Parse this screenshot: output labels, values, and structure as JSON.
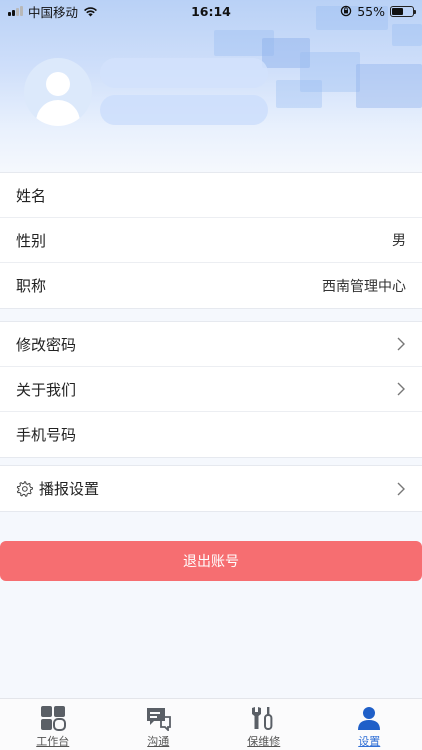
{
  "status_bar": {
    "carrier": "中国移动",
    "time": "16:14",
    "battery": "55%",
    "battery_level": 0.55
  },
  "profile": {
    "avatar_icon": "user-avatar-icon"
  },
  "info_rows": [
    {
      "label": "姓名",
      "value": ""
    },
    {
      "label": "性别",
      "value": "男"
    },
    {
      "label": "职称",
      "value": "西南管理中心"
    }
  ],
  "menu_rows": [
    {
      "label": "修改密码"
    },
    {
      "label": "关于我们"
    },
    {
      "label": "手机号码"
    }
  ],
  "settings_row": {
    "label": "播报设置",
    "icon": "gear-icon"
  },
  "logout_label": "退出账号",
  "tabs": [
    {
      "label": "工作台",
      "icon": "grid-icon"
    },
    {
      "label": "沟通",
      "icon": "chat-icon"
    },
    {
      "label": "保维修",
      "icon": "wrench-icon"
    },
    {
      "label": "设置",
      "icon": "user-icon",
      "active": true
    }
  ],
  "colors": {
    "accent": "#2f6fd6",
    "logout": "#f66e71",
    "header": "#b9d1f6"
  }
}
